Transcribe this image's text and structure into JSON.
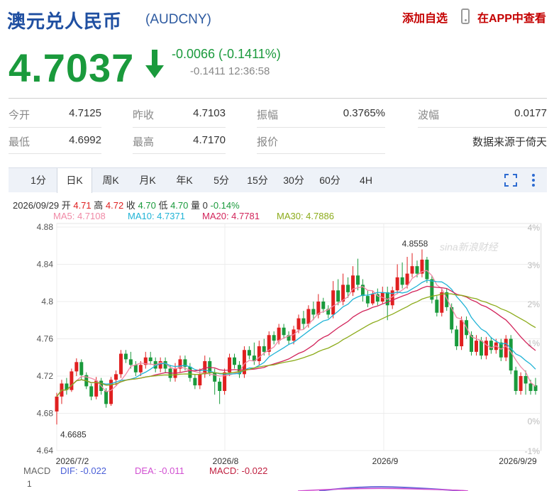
{
  "header": {
    "title": "澳元兑人民币",
    "code": "(AUDCNY)",
    "add_watch": "添加自选",
    "app_view": "在APP中查看"
  },
  "quote": {
    "price": "4.7037",
    "change": "-0.0066 (-0.1411%)",
    "sub": "-0.1411 12:36:58",
    "up_color": "#e02020",
    "down_color": "#1a9a3c"
  },
  "stats": [
    [
      {
        "label": "今开",
        "value": "4.7125"
      },
      {
        "label": "昨收",
        "value": "4.7103"
      },
      {
        "label": "振幅",
        "value": "0.3765%"
      },
      {
        "label": "波幅",
        "value": "0.0177"
      }
    ],
    [
      {
        "label": "最低",
        "value": "4.6992"
      },
      {
        "label": "最高",
        "value": "4.7170"
      },
      {
        "label": "报价",
        "value": ""
      },
      {
        "label": "",
        "value": "数据来源于倚天"
      }
    ]
  ],
  "tabs": [
    "1分",
    "日K",
    "周K",
    "月K",
    "年K",
    "5分",
    "15分",
    "30分",
    "60分",
    "4H"
  ],
  "active_tab": "日K",
  "info_bar": {
    "date": "2026/09/29",
    "open_label": "开",
    "open": "4.71",
    "high_label": "高",
    "high": "4.72",
    "close_label": "收",
    "close": "4.70",
    "low_label": "低",
    "low": "4.70",
    "vol_label": "量",
    "vol": "0",
    "chg": "-0.14%"
  },
  "ma_legend": [
    {
      "text": "MA5: 4.7108",
      "color": "#f08aa6"
    },
    {
      "text": "MA10: 4.7371",
      "color": "#1fb3d6"
    },
    {
      "text": "MA20: 4.7781",
      "color": "#d2245a"
    },
    {
      "text": "MA30: 4.7886",
      "color": "#8cab1a"
    }
  ],
  "macd": {
    "label": "MACD",
    "dif": "DIF: -0.022",
    "dea": "DEA: -0.011",
    "macd": "MACD: -0.022",
    "dif_color": "#4a5fd8",
    "dea_color": "#d14fd1",
    "macd_color": "#c02040",
    "axis_top": "1"
  },
  "chart_data": {
    "type": "candlestick",
    "title": "",
    "y_ticks": [
      "4.88",
      "4.84",
      "4.8",
      "4.76",
      "4.72",
      "4.68",
      "4.64"
    ],
    "ylim": [
      4.64,
      4.88
    ],
    "pct_ticks": [
      "4%",
      "3%",
      "2%",
      "1%",
      "0%",
      "-1%"
    ],
    "x_ticks": [
      "2026/7/2",
      "2026/8",
      "2026/9",
      "2026/9/29"
    ],
    "annotations": [
      {
        "text": "4.8558"
      },
      {
        "text": "4.6685"
      }
    ],
    "watermark": "sina新浪财经",
    "candles": [
      [
        4.682,
        4.698,
        4.702,
        4.668
      ],
      [
        4.698,
        4.712,
        4.716,
        4.69
      ],
      [
        4.712,
        4.705,
        4.718,
        4.7
      ],
      [
        4.705,
        4.725,
        4.728,
        4.703
      ],
      [
        4.725,
        4.735,
        4.739,
        4.72
      ],
      [
        4.735,
        4.721,
        4.738,
        4.716
      ],
      [
        4.721,
        4.709,
        4.724,
        4.706
      ],
      [
        4.709,
        4.698,
        4.712,
        4.694
      ],
      [
        4.698,
        4.715,
        4.719,
        4.695
      ],
      [
        4.715,
        4.704,
        4.718,
        4.7
      ],
      [
        4.704,
        4.69,
        4.707,
        4.686
      ],
      [
        4.69,
        4.716,
        4.719,
        4.688
      ],
      [
        4.716,
        4.722,
        4.726,
        4.71
      ],
      [
        4.722,
        4.744,
        4.748,
        4.718
      ],
      [
        4.744,
        4.738,
        4.748,
        4.734
      ],
      [
        4.738,
        4.732,
        4.746,
        4.728
      ],
      [
        4.732,
        4.724,
        4.736,
        4.72
      ],
      [
        4.724,
        4.732,
        4.736,
        4.72
      ],
      [
        4.732,
        4.74,
        4.746,
        4.728
      ],
      [
        4.74,
        4.736,
        4.746,
        4.732
      ],
      [
        4.736,
        4.728,
        4.74,
        4.724
      ],
      [
        4.728,
        4.736,
        4.74,
        4.724
      ],
      [
        4.736,
        4.728,
        4.74,
        4.724
      ],
      [
        4.728,
        4.718,
        4.732,
        4.714
      ],
      [
        4.718,
        4.728,
        4.734,
        4.714
      ],
      [
        4.728,
        4.738,
        4.742,
        4.724
      ],
      [
        4.738,
        4.73,
        4.742,
        4.726
      ],
      [
        4.73,
        4.718,
        4.734,
        4.714
      ],
      [
        4.718,
        4.71,
        4.722,
        4.706
      ],
      [
        4.71,
        4.722,
        4.728,
        4.706
      ],
      [
        4.722,
        4.736,
        4.742,
        4.718
      ],
      [
        4.736,
        4.724,
        4.74,
        4.72
      ],
      [
        4.724,
        4.714,
        4.728,
        4.7
      ],
      [
        4.714,
        4.704,
        4.718,
        4.69
      ],
      [
        4.704,
        4.724,
        4.728,
        4.7
      ],
      [
        4.724,
        4.74,
        4.744,
        4.72
      ],
      [
        4.74,
        4.732,
        4.744,
        4.728
      ],
      [
        4.732,
        4.722,
        4.736,
        4.718
      ],
      [
        4.722,
        4.748,
        4.752,
        4.718
      ],
      [
        4.748,
        4.742,
        4.752,
        4.738
      ],
      [
        4.742,
        4.736,
        4.756,
        4.732
      ],
      [
        4.736,
        4.752,
        4.758,
        4.732
      ],
      [
        4.752,
        4.746,
        4.76,
        4.742
      ],
      [
        4.746,
        4.764,
        4.768,
        4.742
      ],
      [
        4.764,
        4.758,
        4.768,
        4.754
      ],
      [
        4.758,
        4.772,
        4.776,
        4.754
      ],
      [
        4.772,
        4.764,
        4.776,
        4.76
      ],
      [
        4.764,
        4.758,
        4.768,
        4.754
      ],
      [
        4.758,
        4.77,
        4.774,
        4.754
      ],
      [
        4.77,
        4.782,
        4.786,
        4.766
      ],
      [
        4.782,
        4.776,
        4.79,
        4.77
      ],
      [
        4.776,
        4.792,
        4.796,
        4.772
      ],
      [
        4.792,
        4.786,
        4.8,
        4.78
      ],
      [
        4.786,
        4.8,
        4.808,
        4.782
      ],
      [
        4.8,
        4.792,
        4.804,
        4.788
      ],
      [
        4.792,
        4.786,
        4.796,
        4.782
      ],
      [
        4.786,
        4.812,
        4.822,
        4.782
      ],
      [
        4.812,
        4.8,
        4.824,
        4.796
      ],
      [
        4.8,
        4.818,
        4.83,
        4.796
      ],
      [
        4.818,
        4.81,
        4.826,
        4.804
      ],
      [
        4.81,
        4.828,
        4.838,
        4.806
      ],
      [
        4.828,
        4.818,
        4.846,
        4.812
      ],
      [
        4.818,
        4.806,
        4.824,
        4.8
      ],
      [
        4.806,
        4.798,
        4.812,
        4.794
      ],
      [
        4.798,
        4.808,
        4.812,
        4.796
      ],
      [
        4.808,
        4.8,
        4.814,
        4.796
      ],
      [
        4.8,
        4.81,
        4.816,
        4.798
      ],
      [
        4.81,
        4.796,
        4.816,
        4.78
      ],
      [
        4.796,
        4.812,
        4.816,
        4.792
      ],
      [
        4.812,
        4.826,
        4.84,
        4.808
      ],
      [
        4.826,
        4.818,
        4.842,
        4.814
      ],
      [
        4.818,
        4.83,
        4.848,
        4.814
      ],
      [
        4.83,
        4.838,
        4.852,
        4.826
      ],
      [
        4.838,
        4.83,
        4.844,
        4.826
      ],
      [
        4.83,
        4.845,
        4.856,
        4.826
      ],
      [
        4.845,
        4.824,
        4.848,
        4.82
      ],
      [
        4.824,
        4.802,
        4.828,
        4.798
      ],
      [
        4.802,
        4.788,
        4.806,
        4.784
      ],
      [
        4.788,
        4.81,
        4.814,
        4.784
      ],
      [
        4.81,
        4.794,
        4.814,
        4.79
      ],
      [
        4.794,
        4.77,
        4.798,
        4.766
      ],
      [
        4.77,
        4.752,
        4.774,
        4.748
      ],
      [
        4.752,
        4.78,
        4.784,
        4.748
      ],
      [
        4.78,
        4.764,
        4.784,
        4.76
      ],
      [
        4.764,
        4.746,
        4.768,
        4.742
      ],
      [
        4.746,
        4.758,
        4.764,
        4.742
      ],
      [
        4.758,
        4.742,
        4.762,
        4.738
      ],
      [
        4.742,
        4.758,
        4.762,
        4.738
      ],
      [
        4.758,
        4.748,
        4.762,
        4.744
      ],
      [
        4.748,
        4.756,
        4.76,
        4.744
      ],
      [
        4.756,
        4.74,
        4.76,
        4.736
      ],
      [
        4.74,
        4.76,
        4.764,
        4.736
      ],
      [
        4.76,
        4.726,
        4.764,
        4.722
      ],
      [
        4.726,
        4.704,
        4.73,
        4.7
      ],
      [
        4.704,
        4.72,
        4.724,
        4.7
      ],
      [
        4.72,
        4.712,
        4.726,
        4.7
      ],
      [
        4.712,
        4.704,
        4.716,
        4.7
      ],
      [
        4.71,
        4.704,
        4.718,
        4.7
      ]
    ]
  }
}
